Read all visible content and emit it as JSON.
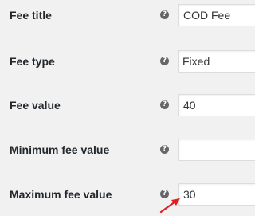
{
  "settings": {
    "rows": [
      {
        "label": "Fee title",
        "help_icon": "question-mark-icon",
        "input": {
          "type": "text",
          "value": "COD Fee",
          "placeholder": ""
        }
      },
      {
        "label": "Fee type",
        "help_icon": "question-mark-icon",
        "input": {
          "type": "select",
          "value": "Fixed",
          "options": [
            "Fixed"
          ]
        }
      },
      {
        "label": "Fee value",
        "help_icon": "question-mark-icon",
        "input": {
          "type": "text",
          "value": "40",
          "placeholder": ""
        }
      },
      {
        "label": "Minimum fee value",
        "help_icon": "question-mark-icon",
        "input": {
          "type": "text",
          "value": "",
          "placeholder": ""
        }
      },
      {
        "label": "Maximum fee value",
        "help_icon": "question-mark-icon",
        "input": {
          "type": "text",
          "value": "30",
          "placeholder": ""
        }
      }
    ],
    "help_glyph": "?"
  },
  "annotation": {
    "arrow_color": "#e02020",
    "points_to": "maximum-fee-value-input"
  },
  "colors": {
    "page_background": "#f1f1f1",
    "label_text": "#23282d",
    "help_icon": "#666666",
    "input_border": "#dddddd"
  }
}
